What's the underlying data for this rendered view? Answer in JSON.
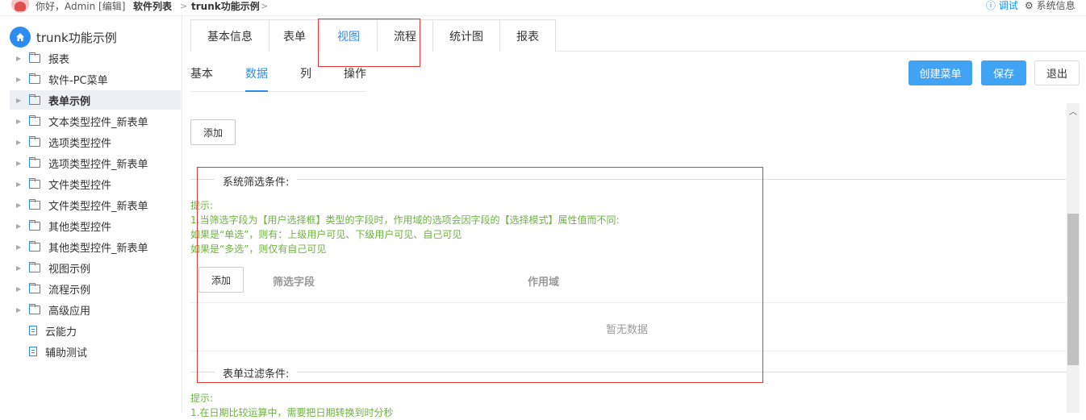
{
  "topbar": {
    "greeting": "你好，Admin [编辑]",
    "crumb1": "软件列表",
    "crumb_sep": ">",
    "crumb2": "trunk功能示例",
    "debug": "ⓘ 调试",
    "sysinfo": "⚙ 系统信息"
  },
  "sidebar": {
    "root": "trunk功能示例",
    "items": [
      {
        "label": "报表",
        "type": "folder"
      },
      {
        "label": "软件-PC菜单",
        "type": "folder"
      },
      {
        "label": "表单示例",
        "type": "folder",
        "active": true
      },
      {
        "label": "文本类型控件_新表单",
        "type": "folder"
      },
      {
        "label": "选项类型控件",
        "type": "folder"
      },
      {
        "label": "选项类型控件_新表单",
        "type": "folder"
      },
      {
        "label": "文件类型控件",
        "type": "folder"
      },
      {
        "label": "文件类型控件_新表单",
        "type": "folder"
      },
      {
        "label": "其他类型控件",
        "type": "folder"
      },
      {
        "label": "其他类型控件_新表单",
        "type": "folder"
      },
      {
        "label": "视图示例",
        "type": "folder"
      },
      {
        "label": "流程示例",
        "type": "folder"
      },
      {
        "label": "高级应用",
        "type": "folder"
      },
      {
        "label": "云能力",
        "type": "doc"
      },
      {
        "label": "辅助测试",
        "type": "doc"
      }
    ]
  },
  "top_tabs": [
    "基本信息",
    "表单",
    "视图",
    "流程",
    "统计图",
    "报表"
  ],
  "sub_tabs": [
    "基本",
    "数据",
    "列",
    "操作"
  ],
  "actions": {
    "create_menu": "创建菜单",
    "save": "保存",
    "exit": "退出"
  },
  "content": {
    "add": "添加",
    "system_filter_title": "系统筛选条件:",
    "hint_lines": [
      "提示:",
      "1.当筛选字段为【用户选择框】类型的字段时，作用域的选项会因字段的【选择模式】属性值而不同:",
      "如果是“单选”，则有：上级用户可见、下级用户可见、自己可见",
      "如果是“多选”，则仅有自己可见"
    ],
    "table_add": "添加",
    "col_filter_field": "筛选字段",
    "col_scope": "作用域",
    "empty_text": "暂无数据",
    "form_filter_title": "表单过滤条件:",
    "hint2_lines": [
      "提示:",
      "1.在日期比较运算中，需要把日期转换到时分秒"
    ]
  },
  "colors": {
    "primary": "#2d8cf0",
    "button": "#41a3f4",
    "hint": "#6cb33e",
    "highlight": "#e53935"
  }
}
